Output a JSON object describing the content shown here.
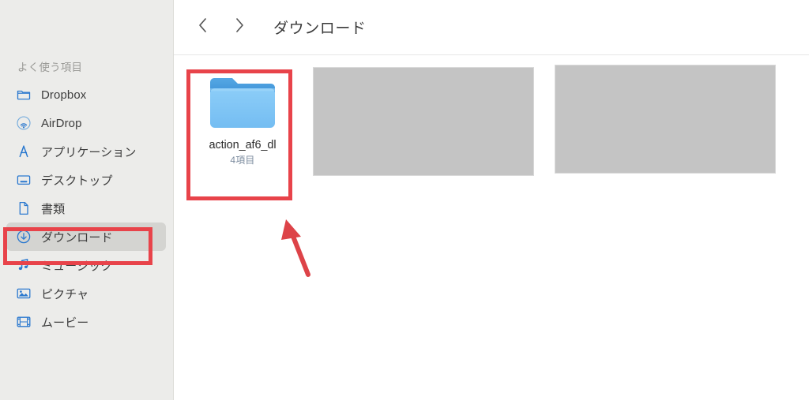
{
  "window": {
    "app": "Finder"
  },
  "toolbar": {
    "back_icon": "chevron-left-icon",
    "forward_icon": "chevron-right-icon",
    "title": "ダウンロード"
  },
  "sidebar": {
    "section_title": "よく使う項目",
    "items": [
      {
        "label": "Dropbox",
        "icon": "folder-outline-icon",
        "selected": false
      },
      {
        "label": "AirDrop",
        "icon": "airdrop-icon",
        "selected": false
      },
      {
        "label": "アプリケーション",
        "icon": "applications-icon",
        "selected": false
      },
      {
        "label": "デスクトップ",
        "icon": "desktop-icon",
        "selected": false
      },
      {
        "label": "書類",
        "icon": "document-icon",
        "selected": false
      },
      {
        "label": "ダウンロード",
        "icon": "download-icon",
        "selected": true
      },
      {
        "label": "ミュージック",
        "icon": "music-note-icon",
        "selected": false
      },
      {
        "label": "ピクチャ",
        "icon": "picture-icon",
        "selected": false
      },
      {
        "label": "ムービー",
        "icon": "movie-icon",
        "selected": false
      }
    ]
  },
  "content": {
    "folder": {
      "name": "action_af6_dl",
      "count_label": "4項目",
      "icon": "folder-icon"
    },
    "redacted_items": [
      {
        "label": ""
      },
      {
        "label": ""
      }
    ]
  },
  "annotations": {
    "highlight_color": "#e8434a",
    "sidebar_box_target": "ダウンロード",
    "folder_box_target": "action_af6_dl",
    "arrow": "red-arrow-pointing-to-folder"
  },
  "colors": {
    "sidebar_background": "#ececea",
    "selection_background": "#d4d4d1",
    "folder_body": "#7fc4f5",
    "folder_tab": "#4a9fe0",
    "icon_blue": "#2a78cf",
    "annotation_red": "#e8434a",
    "redacted_gray": "#c4c4c4"
  }
}
